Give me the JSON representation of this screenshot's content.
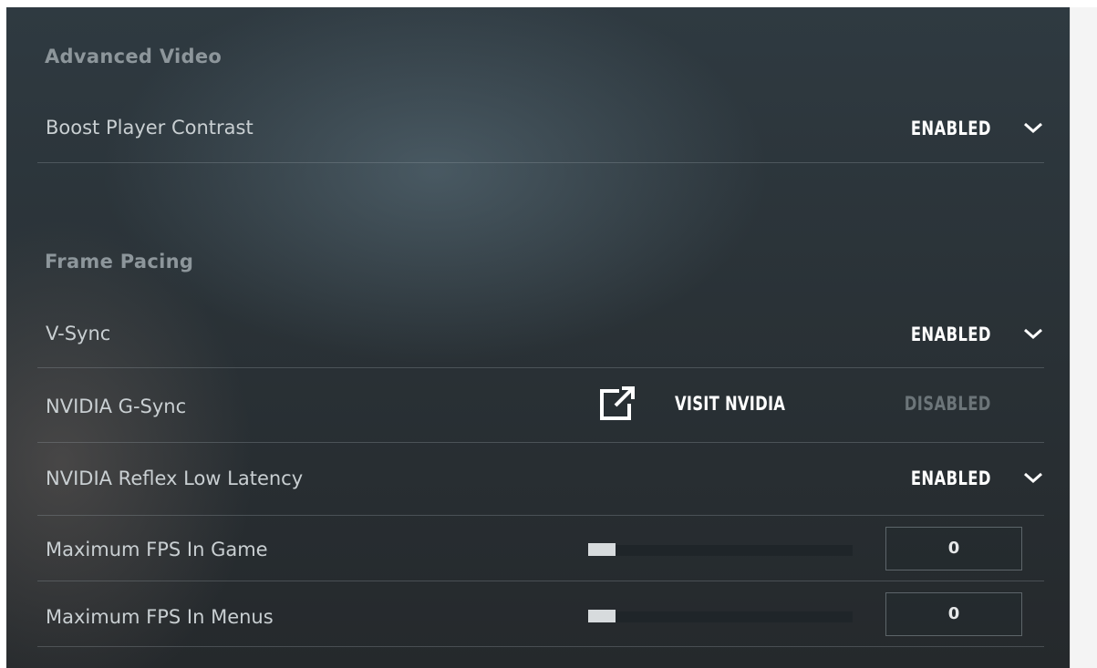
{
  "sections": {
    "advanced_video": "Advanced Video",
    "frame_pacing": "Frame Pacing"
  },
  "settings": {
    "boost_player_contrast": {
      "label": "Boost Player Contrast",
      "value": "ENABLED"
    },
    "vsync": {
      "label": "V-Sync",
      "value": "ENABLED"
    },
    "gsync": {
      "label": "NVIDIA G-Sync",
      "link_label": "VISIT NVIDIA",
      "link_icon": "external-link-icon",
      "value": "DISABLED"
    },
    "reflex": {
      "label": "NVIDIA Reflex Low Latency",
      "value": "ENABLED"
    },
    "max_fps_game": {
      "label": "Maximum FPS In Game",
      "value": "0",
      "slider_fraction": 0
    },
    "max_fps_menus": {
      "label": "Maximum FPS In Menus",
      "value": "0",
      "slider_fraction": 0
    }
  },
  "icons": {
    "dropdown": "chevron-down-icon"
  },
  "colors": {
    "accent_text": "#ffffff",
    "muted_text": "#8d969b",
    "disabled_text": "#6c7579"
  }
}
